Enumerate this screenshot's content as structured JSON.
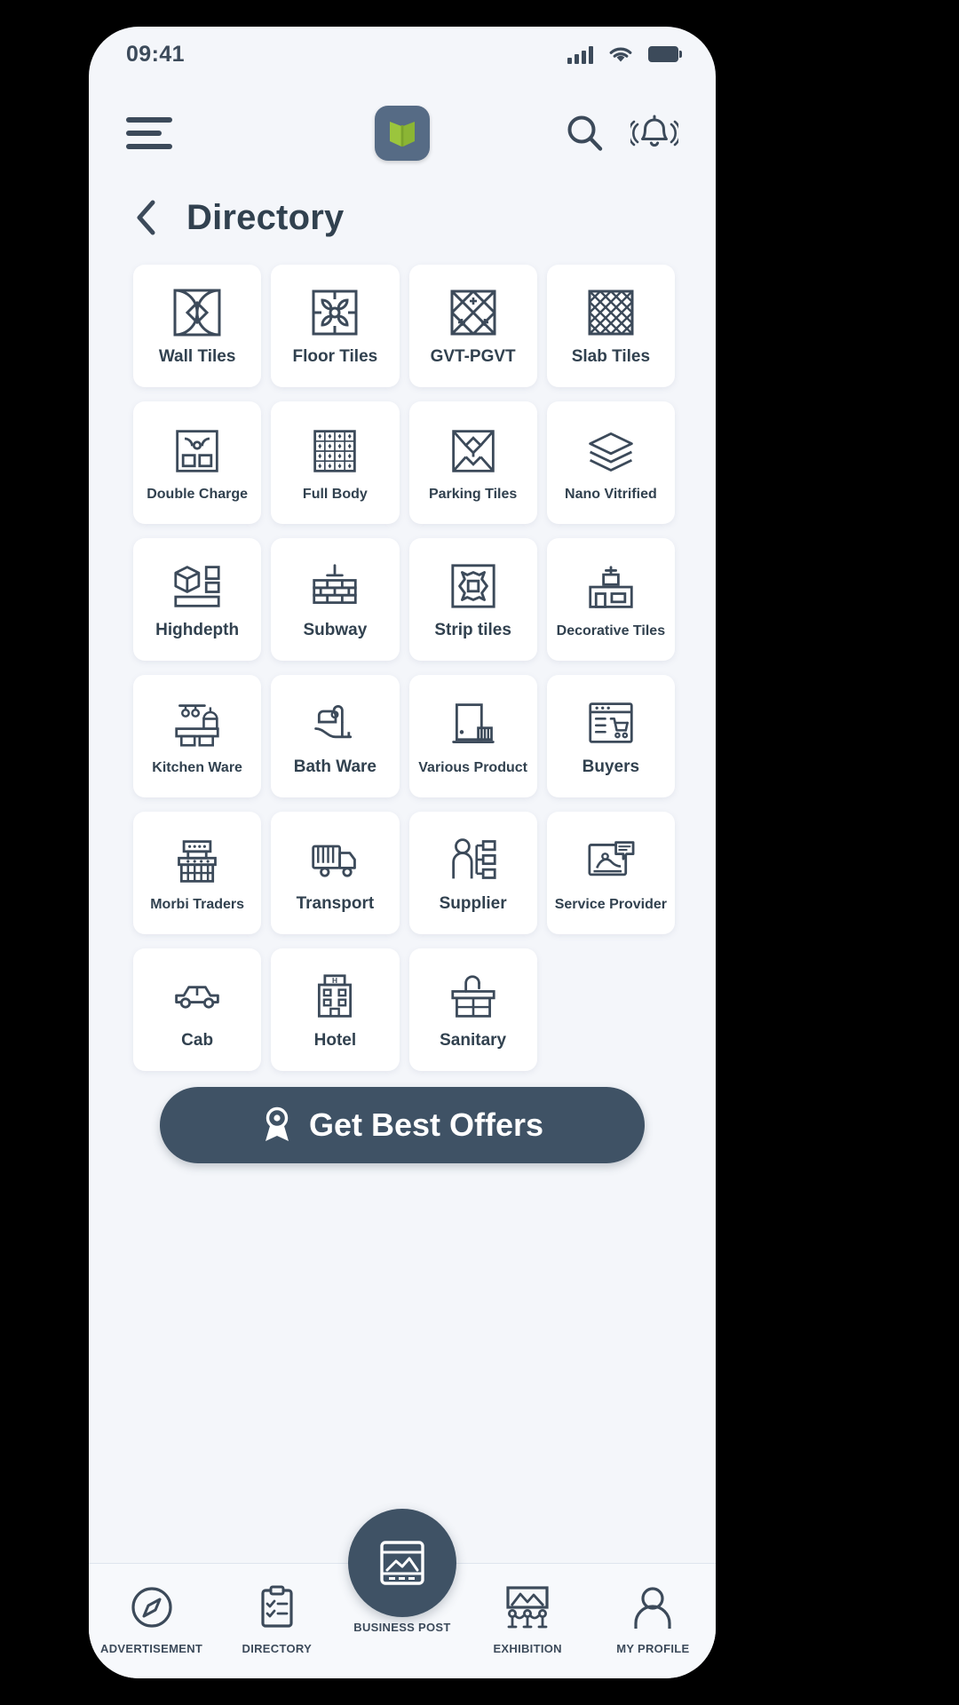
{
  "status_bar": {
    "time": "09:41",
    "icons": [
      "signal-bars-icon",
      "wifi-icon",
      "battery-icon"
    ]
  },
  "header": {
    "menu_icon": "hamburger-menu-icon",
    "logo_icon": "open-book-logo",
    "search_icon": "search-icon",
    "notification_icon": "bell-icon"
  },
  "page": {
    "back_icon": "chevron-left-icon",
    "title": "Directory"
  },
  "directory": {
    "items": [
      {
        "label": "Wall Tiles",
        "icon": "wall-tile-pattern-icon"
      },
      {
        "label": "Floor Tiles",
        "icon": "floor-tile-floral-icon"
      },
      {
        "label": "GVT-PGVT",
        "icon": "gvt-pgvt-diamond-icon"
      },
      {
        "label": "Slab Tiles",
        "icon": "slab-tile-crosshatch-icon"
      },
      {
        "label": "Double Charge",
        "icon": "double-charge-tile-icon"
      },
      {
        "label": "Full Body",
        "icon": "full-body-tile-icon"
      },
      {
        "label": "Parking Tiles",
        "icon": "parking-tile-icon"
      },
      {
        "label": "Nano Vitrified",
        "icon": "nano-vitrified-layers-icon"
      },
      {
        "label": "Highdepth",
        "icon": "highdepth-cube-icon"
      },
      {
        "label": "Subway",
        "icon": "subway-brick-icon"
      },
      {
        "label": "Strip tiles",
        "icon": "strip-tile-icon"
      },
      {
        "label": "Decorative Tiles",
        "icon": "decorative-tiles-icon"
      },
      {
        "label": "Kitchen Ware",
        "icon": "kitchen-ware-icon"
      },
      {
        "label": "Bath Ware",
        "icon": "bathtub-icon"
      },
      {
        "label": "Various Product",
        "icon": "door-product-icon"
      },
      {
        "label": "Buyers",
        "icon": "buyers-cart-icon"
      },
      {
        "label": "Morbi Traders",
        "icon": "traders-building-icon"
      },
      {
        "label": "Transport",
        "icon": "truck-icon"
      },
      {
        "label": "Supplier",
        "icon": "supplier-person-icon"
      },
      {
        "label": "Service Provider",
        "icon": "service-provider-icon"
      },
      {
        "label": "Cab",
        "icon": "car-icon"
      },
      {
        "label": "Hotel",
        "icon": "hotel-building-icon"
      },
      {
        "label": "Sanitary",
        "icon": "sanitary-sink-icon"
      }
    ]
  },
  "cta": {
    "label": "Get Best Offers",
    "icon": "award-ribbon-icon"
  },
  "bottom_nav": {
    "items": [
      {
        "label": "ADVERTISEMENT",
        "icon": "compass-icon"
      },
      {
        "label": "DIRECTORY",
        "icon": "clipboard-checklist-icon"
      },
      {
        "label": "BUSINESS POST",
        "icon": "image-post-icon"
      },
      {
        "label": "EXHIBITION",
        "icon": "exhibition-gallery-icon"
      },
      {
        "label": "MY PROFILE",
        "icon": "user-profile-icon"
      }
    ]
  },
  "colors": {
    "background": "#f4f6fa",
    "card": "#ffffff",
    "primary_text": "#31414f",
    "accent": "#3f5265",
    "logo_green": "#9bc53d"
  }
}
